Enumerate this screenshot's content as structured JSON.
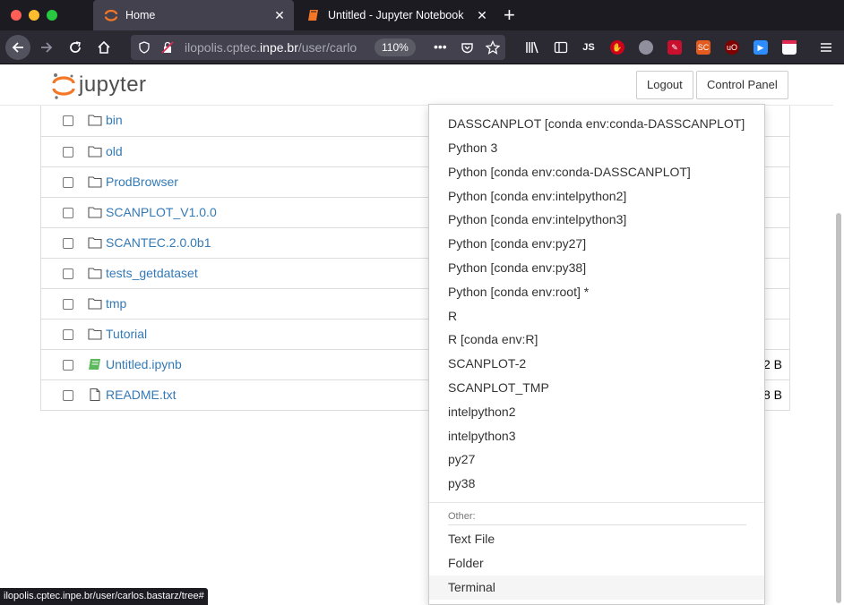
{
  "browser": {
    "tabs": [
      {
        "title": "Home",
        "active": true
      },
      {
        "title": "Untitled - Jupyter Notebook",
        "active": false
      }
    ],
    "url_host_prefix": "ilopolis.cptec.",
    "url_host_main": "inpe.br",
    "url_path": "/user/carlo",
    "zoom": "110%",
    "status_url": "ilopolis.cptec.inpe.br/user/carlos.bastarz/tree#"
  },
  "header": {
    "logo_text": "jupyter",
    "logout_label": "Logout",
    "control_panel_label": "Control Panel"
  },
  "files": [
    {
      "name": "bin",
      "type": "folder",
      "size": ""
    },
    {
      "name": "old",
      "type": "folder",
      "size": ""
    },
    {
      "name": "ProdBrowser",
      "type": "folder",
      "size": ""
    },
    {
      "name": "SCANPLOT_V1.0.0",
      "type": "folder",
      "size": ""
    },
    {
      "name": "SCANTEC.2.0.0b1",
      "type": "folder",
      "size": ""
    },
    {
      "name": "tests_getdataset",
      "type": "folder",
      "size": ""
    },
    {
      "name": "tmp",
      "type": "folder",
      "size": ""
    },
    {
      "name": "Tutorial",
      "type": "folder",
      "size": ""
    },
    {
      "name": "Untitled.ipynb",
      "type": "notebook",
      "size": "2 B"
    },
    {
      "name": "README.txt",
      "type": "file",
      "size": "8 B"
    }
  ],
  "new_menu": {
    "kernels": [
      "DASSCANPLOT [conda env:conda-DASSCANPLOT]",
      "Python 3",
      "Python [conda env:conda-DASSCANPLOT]",
      "Python [conda env:intelpython2]",
      "Python [conda env:intelpython3]",
      "Python [conda env:py27]",
      "Python [conda env:py38]",
      "Python [conda env:root] *",
      "R",
      "R [conda env:R]",
      "SCANPLOT-2",
      "SCANPLOT_TMP",
      "intelpython2",
      "intelpython3",
      "py27",
      "py38"
    ],
    "other_header": "Other:",
    "other": [
      "Text File",
      "Folder",
      "Terminal"
    ],
    "highlighted": "Terminal"
  },
  "colors": {
    "link": "#337ab7",
    "notebook_icon": "#5cb85c",
    "jupyter_orange": "#f37726"
  }
}
